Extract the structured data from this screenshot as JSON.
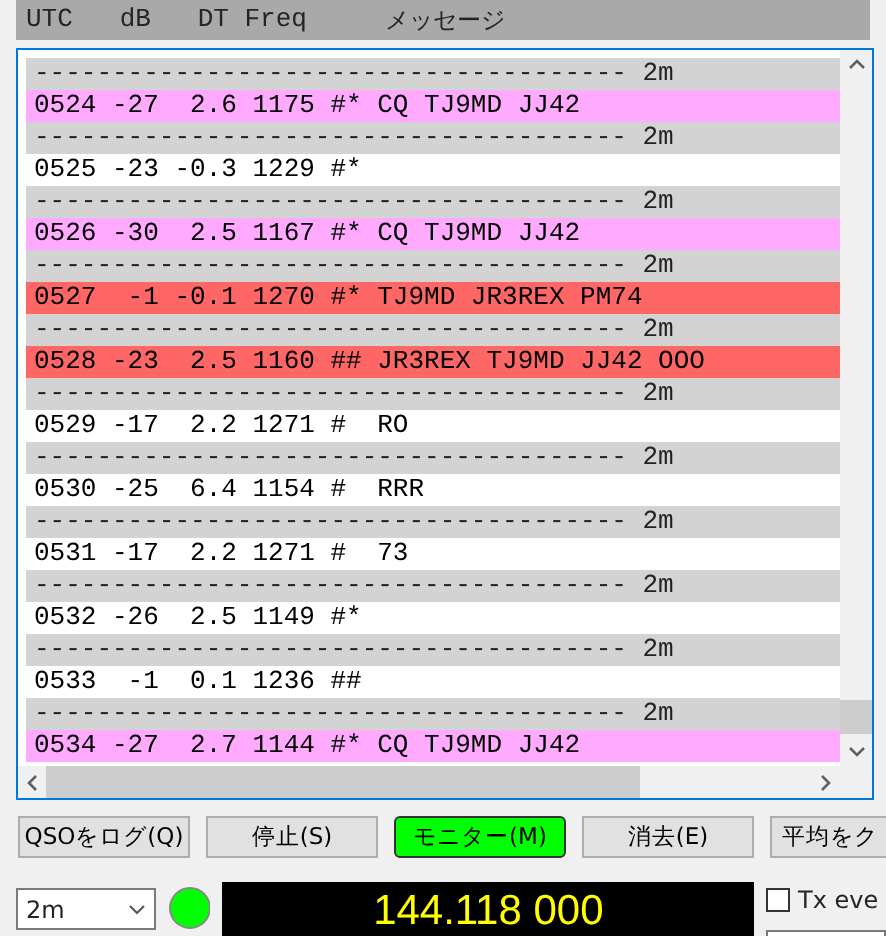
{
  "header": {
    "columns": [
      "UTC",
      "dB",
      "DT",
      "Freq",
      "メッセージ"
    ]
  },
  "lines": [
    {
      "kind": "separator",
      "text": "-------------------------------------- 2m",
      "color": "#d3d3d3"
    },
    {
      "kind": "decode",
      "text": "0524 -27  2.6 1175 #* CQ TJ9MD JJ42",
      "color": "#ffaaff"
    },
    {
      "kind": "separator",
      "text": "-------------------------------------- 2m",
      "color": "#d3d3d3"
    },
    {
      "kind": "decode",
      "text": "0525 -23 -0.3 1229 #*",
      "color": "#ffffff"
    },
    {
      "kind": "separator",
      "text": "-------------------------------------- 2m",
      "color": "#d3d3d3"
    },
    {
      "kind": "decode",
      "text": "0526 -30  2.5 1167 #* CQ TJ9MD JJ42",
      "color": "#ffaaff"
    },
    {
      "kind": "separator",
      "text": "-------------------------------------- 2m",
      "color": "#d3d3d3"
    },
    {
      "kind": "decode",
      "text": "0527  -1 -0.1 1270 #* TJ9MD JR3REX PM74",
      "color": "#ff6666"
    },
    {
      "kind": "separator",
      "text": "-------------------------------------- 2m",
      "color": "#d3d3d3"
    },
    {
      "kind": "decode",
      "text": "0528 -23  2.5 1160 ## JR3REX TJ9MD JJ42 OOO",
      "color": "#ff6666"
    },
    {
      "kind": "separator",
      "text": "-------------------------------------- 2m",
      "color": "#d3d3d3"
    },
    {
      "kind": "decode",
      "text": "0529 -17  2.2 1271 #  RO",
      "color": "#ffffff"
    },
    {
      "kind": "separator",
      "text": "-------------------------------------- 2m",
      "color": "#d3d3d3"
    },
    {
      "kind": "decode",
      "text": "0530 -25  6.4 1154 #  RRR",
      "color": "#ffffff"
    },
    {
      "kind": "separator",
      "text": "-------------------------------------- 2m",
      "color": "#d3d3d3"
    },
    {
      "kind": "decode",
      "text": "0531 -17  2.2 1271 #  73",
      "color": "#ffffff"
    },
    {
      "kind": "separator",
      "text": "-------------------------------------- 2m",
      "color": "#d3d3d3"
    },
    {
      "kind": "decode",
      "text": "0532 -26  2.5 1149 #*",
      "color": "#ffffff"
    },
    {
      "kind": "separator",
      "text": "-------------------------------------- 2m",
      "color": "#d3d3d3"
    },
    {
      "kind": "decode",
      "text": "0533  -1  0.1 1236 ##",
      "color": "#ffffff"
    },
    {
      "kind": "separator",
      "text": "-------------------------------------- 2m",
      "color": "#d3d3d3"
    },
    {
      "kind": "decode",
      "text": "0534 -27  2.7 1144 #* CQ TJ9MD JJ42",
      "color": "#ffaaff"
    }
  ],
  "buttons": [
    {
      "label": "QSOをログ(Q)",
      "selected": false
    },
    {
      "label": "停止(S)",
      "selected": false
    },
    {
      "label": "モニター(M)",
      "selected": true
    },
    {
      "label": "消去(E)",
      "selected": false
    },
    {
      "label": "平均をク",
      "selected": false
    }
  ],
  "band": {
    "value": "2m"
  },
  "status_led": {
    "on": true
  },
  "frequency": "144.118 000",
  "tx_even": {
    "label": "Tx eve",
    "checked": false
  }
}
